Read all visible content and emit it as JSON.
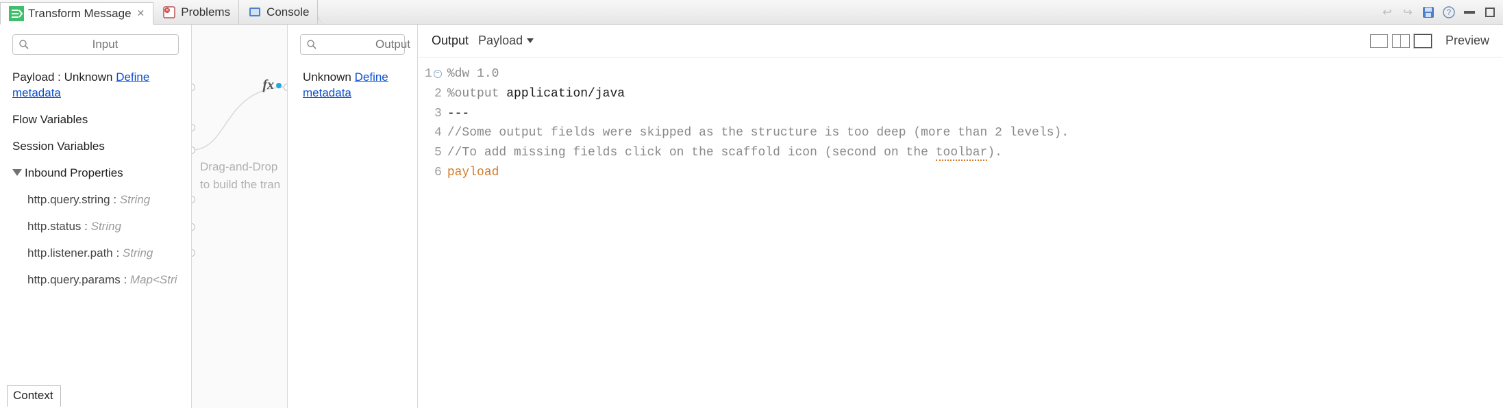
{
  "tabs": {
    "transform": "Transform Message",
    "problems": "Problems",
    "console": "Console"
  },
  "input": {
    "search_placeholder": "Input",
    "payload_prefix": "Payload : Unknown ",
    "define_metadata": "Define metadata",
    "flow_vars": "Flow Variables",
    "session_vars": "Session Variables",
    "inbound_props": "Inbound Properties",
    "props": {
      "p0_name": "http.query.string : ",
      "p0_type": "String",
      "p1_name": "http.status : ",
      "p1_type": "String",
      "p2_name": "http.listener.path : ",
      "p2_type": "String",
      "p3_name": "http.query.params : ",
      "p3_type": "Map<Stri"
    },
    "context_tab": "Context"
  },
  "mapping": {
    "hint_line1": "Drag-and-Drop",
    "hint_line2": "to build the tran",
    "fx_label": "fx"
  },
  "output": {
    "search_placeholder": "Output",
    "unknown_prefix": "Unknown ",
    "define_metadata": "Define metadata"
  },
  "editor": {
    "label": "Output",
    "selector": "Payload",
    "preview": "Preview",
    "lines": {
      "l1a": "%dw",
      "l1b": " 1.0",
      "l2a": "%output",
      "l2b": " application/java",
      "l3": "---",
      "l4": "//Some output fields were skipped as the structure is too deep (more than 2 levels).",
      "l5a": "//To add missing fields click on the scaffold icon (second on the ",
      "l5b": "toolbar",
      "l5c": ").",
      "l6": "payload"
    }
  }
}
